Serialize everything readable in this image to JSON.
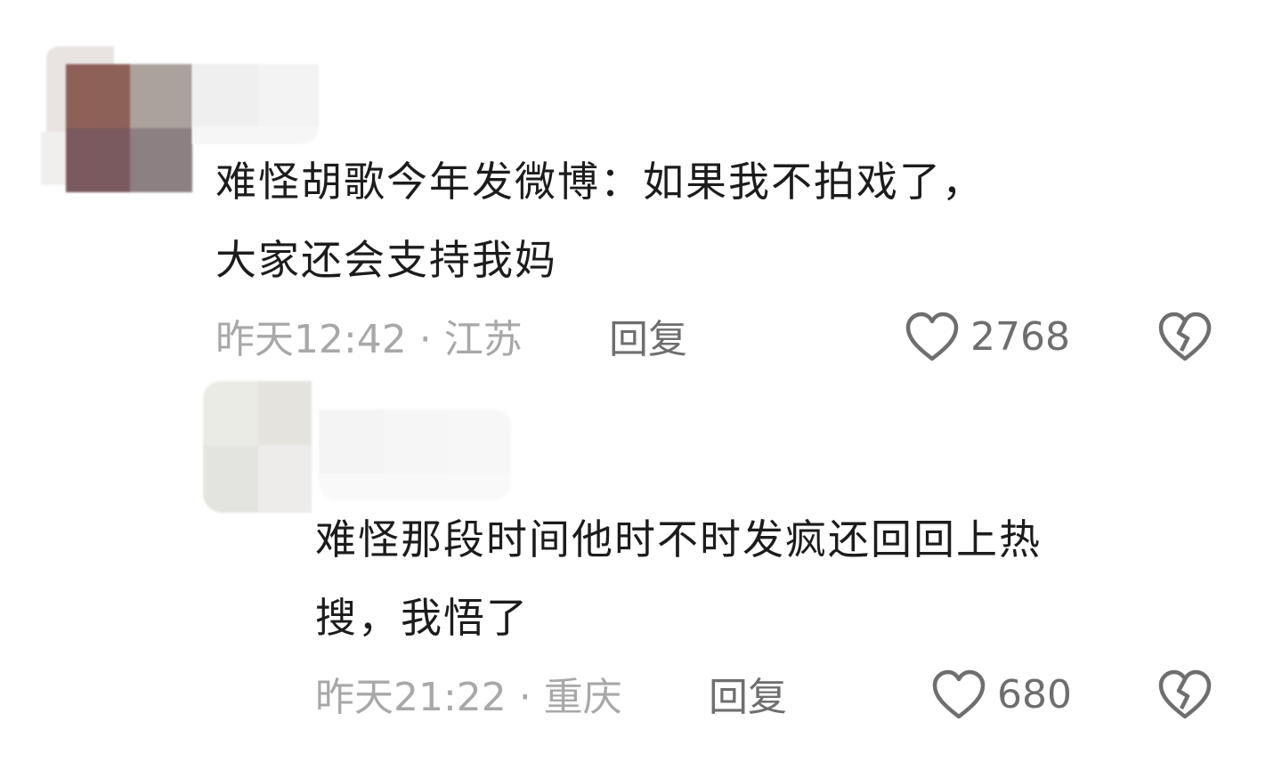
{
  "comments": [
    {
      "text_line1": "难怪胡歌今年发微博：如果我不拍戏了，",
      "text_line2": "大家还会支持我妈",
      "time": "昨天12:42 · 江苏",
      "reply_label": "回复",
      "likes": "2768"
    },
    {
      "text_line1": "难怪那段时间他时不时发疯还回回上热",
      "text_line2": "搜，我悟了",
      "time": "昨天21:22 · 重庆",
      "reply_label": "回复",
      "likes": "680"
    }
  ],
  "colors": {
    "text": "#1c1c1c",
    "meta": "#a8a8a8",
    "action": "#6e6e6e"
  },
  "icons": {
    "like": "heart-outline-icon",
    "dislike": "broken-heart-icon"
  }
}
